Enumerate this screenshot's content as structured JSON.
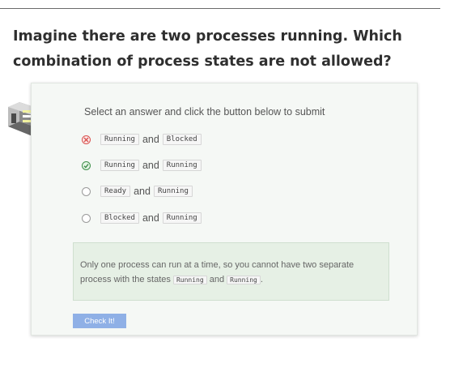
{
  "question": "Imagine there are two processes running. Which combination of process states are not allowed?",
  "prompt": "Select an answer and click the button below to submit",
  "options": [
    {
      "a": "Running",
      "conj": "and",
      "b": "Blocked",
      "state": "incorrect"
    },
    {
      "a": "Running",
      "conj": "and",
      "b": "Running",
      "state": "correct"
    },
    {
      "a": "Ready",
      "conj": "and",
      "b": "Running",
      "state": "unselected"
    },
    {
      "a": "Blocked",
      "conj": "and",
      "b": "Running",
      "state": "unselected"
    }
  ],
  "explanation": {
    "text_before": "Only one process can run at a time, so you cannot have two separate process with the states",
    "code1": "Running",
    "conj": "and",
    "code2": "Running",
    "text_after": "."
  },
  "check_button": "Check It!",
  "colors": {
    "incorrect": "#d9534f",
    "correct": "#3f8f4a",
    "button": "#8fb0e6"
  },
  "icons": {
    "mascot": "server-block-icon",
    "incorrect": "x-circle-icon",
    "correct": "check-circle-icon"
  }
}
